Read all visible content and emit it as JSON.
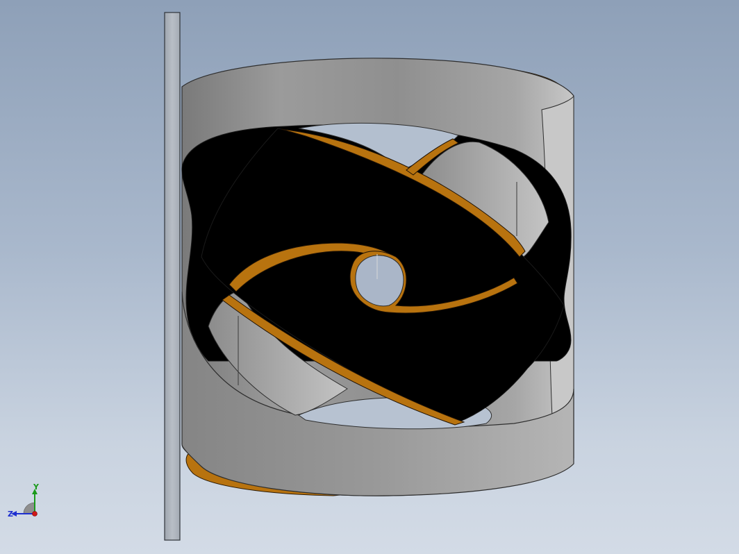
{
  "viewport": {
    "background_top": "#8ea0b8",
    "background_bottom": "#d3dbe6"
  },
  "model": {
    "parts": [
      "mounting-plate",
      "helical-band-front",
      "helical-band-back",
      "inner-spiral-ring"
    ],
    "colors": {
      "band": "#9a9a9a",
      "band_light": "#c2c2c2",
      "band_dark": "#6f6f6f",
      "inner": "#000000",
      "rim": "#b8730f",
      "plate": "#b3b9c2"
    }
  },
  "triad": {
    "y_label": "Y",
    "z_label": "Z",
    "y_color": "#1a9a1a",
    "z_color": "#1d2fd0",
    "x_color": "#d01818"
  }
}
